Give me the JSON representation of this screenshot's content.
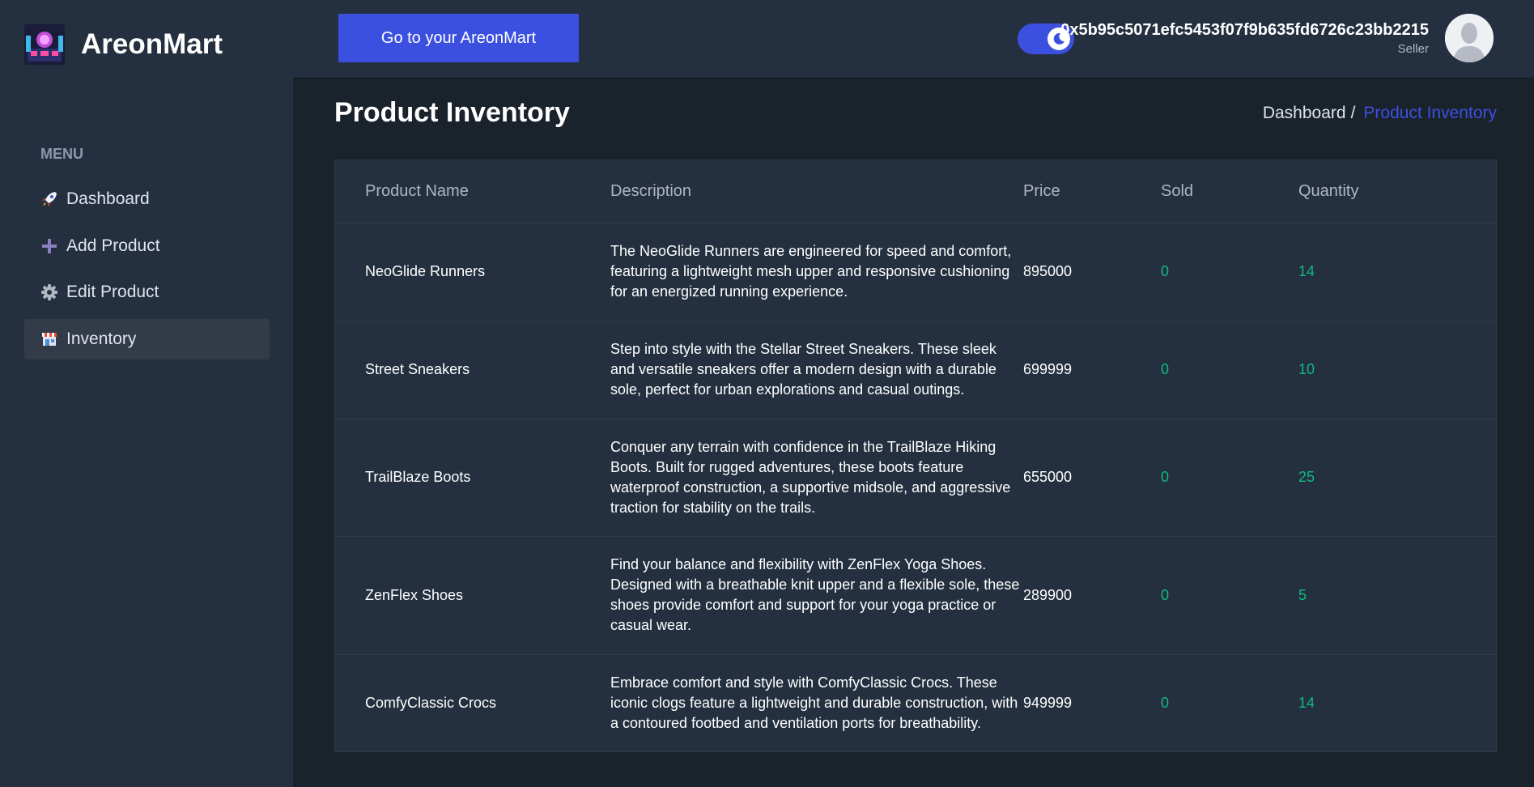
{
  "brand": {
    "name": "AreonMart"
  },
  "header": {
    "goto_button": "Go to your AreonMart",
    "user_address": "0x5b95c5071efc5453f07f9b635fd6726c23bb2215",
    "user_role": "Seller"
  },
  "sidebar": {
    "menu_title": "MENU",
    "items": [
      {
        "label": "Dashboard",
        "icon": "rocket-icon"
      },
      {
        "label": "Add Product",
        "icon": "plus-icon"
      },
      {
        "label": "Edit Product",
        "icon": "gear-icon"
      },
      {
        "label": "Inventory",
        "icon": "store-icon",
        "active": true
      }
    ]
  },
  "page": {
    "title": "Product Inventory",
    "breadcrumb": {
      "home": "Dashboard",
      "separator": "/",
      "current": "Product Inventory"
    }
  },
  "table": {
    "headers": [
      "Product Name",
      "Description",
      "Price",
      "Sold",
      "Quantity"
    ],
    "rows": [
      {
        "name": "NeoGlide Runners",
        "description": "The NeoGlide Runners are engineered for speed and comfort, featuring a lightweight mesh upper and responsive cushioning for an energized running experience.",
        "price": "895000",
        "sold": "0",
        "quantity": "14"
      },
      {
        "name": "Street Sneakers",
        "description": "Step into style with the Stellar Street Sneakers. These sleek and versatile sneakers offer a modern design with a durable sole, perfect for urban explorations and casual outings.",
        "price": "699999",
        "sold": "0",
        "quantity": "10"
      },
      {
        "name": "TrailBlaze Boots",
        "description": "Conquer any terrain with confidence in the TrailBlaze Hiking Boots. Built for rugged adventures, these boots feature waterproof construction, a supportive midsole, and aggressive traction for stability on the trails.",
        "price": "655000",
        "sold": "0",
        "quantity": "25"
      },
      {
        "name": "ZenFlex Shoes",
        "description": "Find your balance and flexibility with ZenFlex Yoga Shoes. Designed with a breathable knit upper and a flexible sole, these shoes provide comfort and support for your yoga practice or casual wear.",
        "price": "289900",
        "sold": "0",
        "quantity": "5"
      },
      {
        "name": "ComfyClassic Crocs",
        "description": "Embrace comfort and style with ComfyClassic Crocs. These iconic clogs feature a lightweight and durable construction, with a contoured footbed and ventilation ports for breathability.",
        "price": "949999",
        "sold": "0",
        "quantity": "14"
      }
    ]
  },
  "colors": {
    "accent": "#3c50e0",
    "positive": "#10b981",
    "background": "#1a222c",
    "panel": "#24303f"
  }
}
